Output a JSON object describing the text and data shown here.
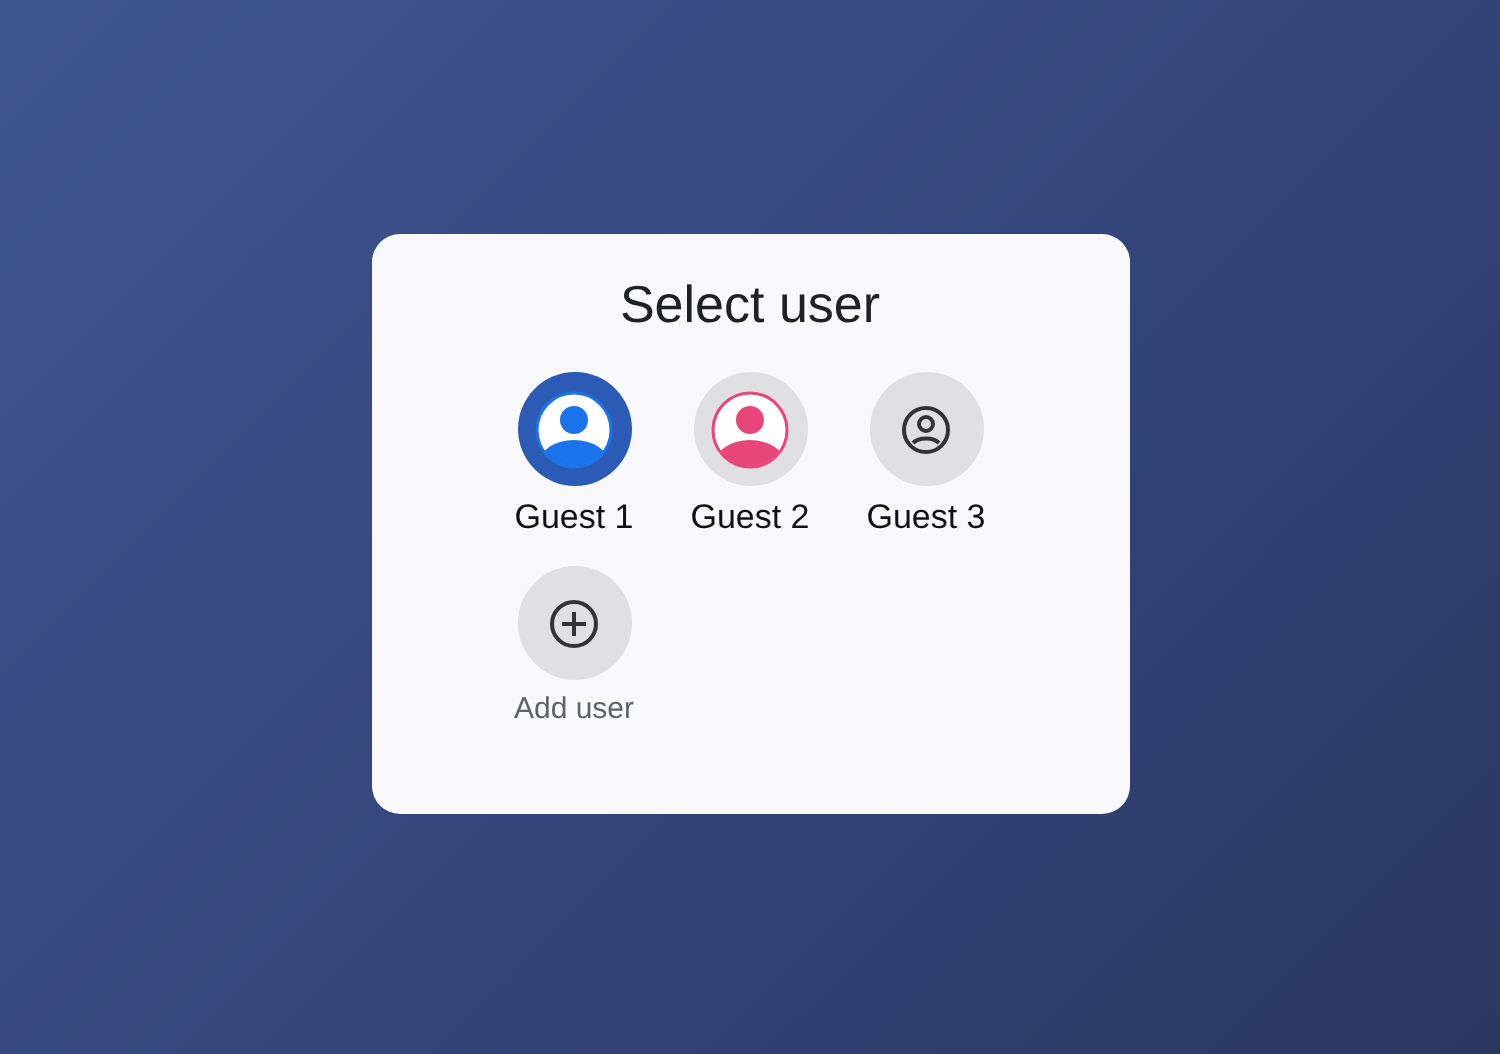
{
  "dialog": {
    "title": "Select user",
    "users": [
      {
        "kind": "avatar",
        "name": "Guest 1",
        "selected": true,
        "color": "#1a73e8"
      },
      {
        "kind": "avatar",
        "name": "Guest 2",
        "selected": false,
        "color": "#e8457a"
      },
      {
        "kind": "generic",
        "name": "Guest 3",
        "selected": false
      },
      {
        "kind": "add",
        "name": "Add user",
        "selected": false
      }
    ]
  }
}
